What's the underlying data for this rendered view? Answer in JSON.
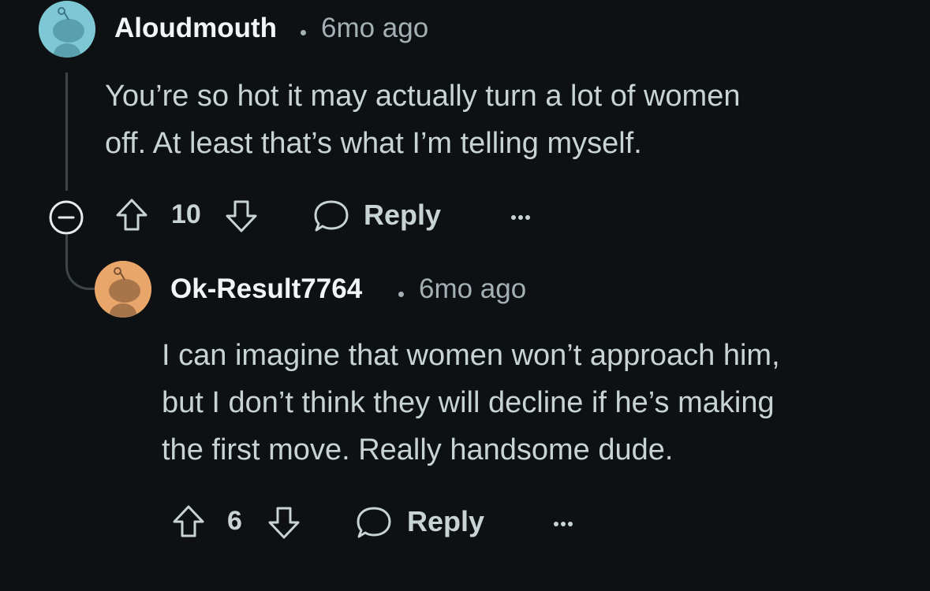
{
  "comments": [
    {
      "author": "Aloudmouth",
      "time": "6mo ago",
      "body": "You’re so hot it may actually turn a lot of women\noff. At least that’s what I’m telling myself.",
      "score": "10",
      "reply_label": "Reply",
      "avatar_color": "#7ec8d6"
    },
    {
      "author": "Ok-Result7764",
      "time": "6mo ago",
      "body": "I can imagine that women won’t approach him,\nbut I don’t think they will decline if he’s making\nthe first move. Really handsome dude.",
      "score": "6",
      "reply_label": "Reply",
      "avatar_color": "#e9a66b"
    }
  ],
  "icons": {
    "collapse": "collapse-minus-icon",
    "upvote": "arrow-up-icon",
    "downvote": "arrow-down-icon",
    "reply": "speech-bubble-icon",
    "more": "ellipsis-icon"
  },
  "colors": {
    "background": "#0e1113",
    "author_text": "#f2f4f5",
    "body_text": "#c8d3d6",
    "meta_text": "#a3b0b4"
  }
}
